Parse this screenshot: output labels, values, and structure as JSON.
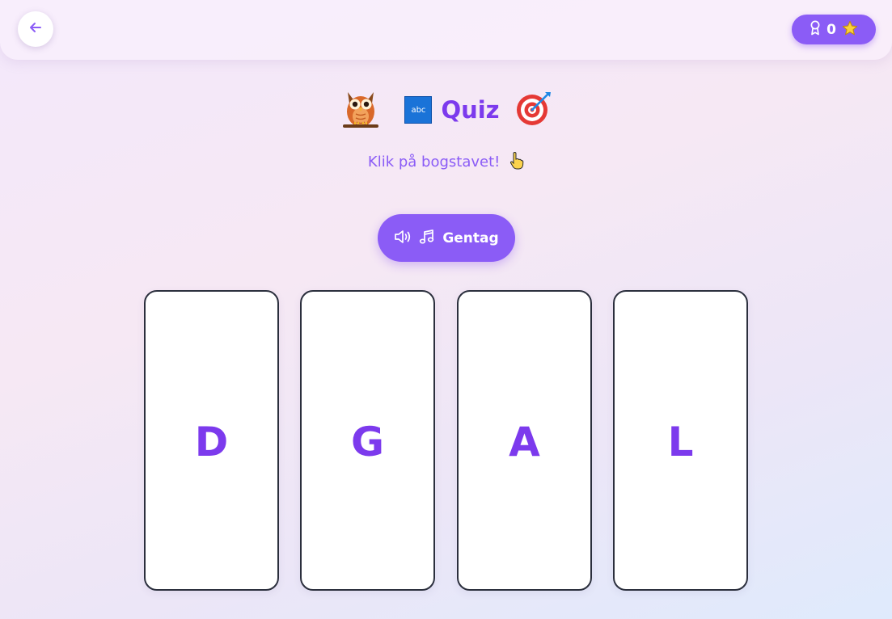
{
  "header": {
    "score": "0",
    "back_icon": "arrow-left-icon",
    "badge_icon": "award-icon",
    "star_icon": "star-icon",
    "accent_color": "#8b5cf6"
  },
  "title": {
    "text": "Quiz",
    "abc_label": "abc",
    "icons": [
      "owl-icon",
      "abc-icon",
      "target-icon"
    ]
  },
  "instruction": {
    "text": "Klik på bogstavet!",
    "icon": "pointing-hand-icon"
  },
  "repeat_button": {
    "label": "Gentag",
    "icons": [
      "speaker-icon",
      "music-note-icon"
    ]
  },
  "cards": [
    {
      "letter": "D"
    },
    {
      "letter": "G"
    },
    {
      "letter": "A"
    },
    {
      "letter": "L"
    }
  ]
}
